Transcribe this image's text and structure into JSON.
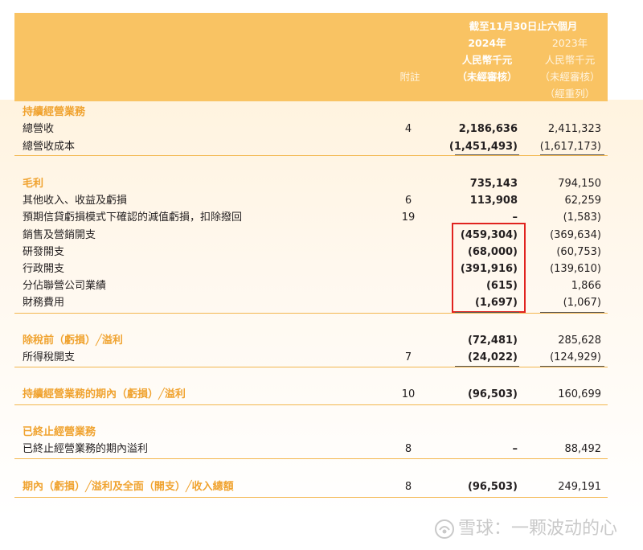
{
  "header": {
    "period": "截至11月30日止六個月",
    "col_2024_year": "2024年",
    "col_2024_unit": "人民幣千元",
    "col_2024_audit": "（未經審核）",
    "col_2023_year": "2023年",
    "col_2023_unit": "人民幣千元",
    "col_2023_audit": "（未經審核）",
    "col_2023_restated": "（經重列）",
    "notes_label": "附註"
  },
  "rows": [
    {
      "label": "持續經營業務",
      "note": "",
      "v2024": "",
      "v2023": "",
      "section": true
    },
    {
      "label": "總營收",
      "note": "4",
      "v2024": "2,186,636",
      "v2023": "2,411,323"
    },
    {
      "label": "總營收成本",
      "note": "",
      "v2024": "(1,451,493)",
      "v2023": "(1,617,173)"
    },
    {
      "label": "毛利",
      "note": "",
      "v2024": "735,143",
      "v2023": "794,150",
      "section": true
    },
    {
      "label": "其他收入、收益及虧損",
      "note": "6",
      "v2024": "113,908",
      "v2023": "62,259"
    },
    {
      "label": "預期信貸虧損模式下確認的減值虧損，扣除撥回",
      "note": "19",
      "v2024": "–",
      "v2023": "(1,583)"
    },
    {
      "label": "銷售及營銷開支",
      "note": "",
      "v2024": "(459,304)",
      "v2023": "(369,634)"
    },
    {
      "label": "研發開支",
      "note": "",
      "v2024": "(68,000)",
      "v2023": "(60,753)"
    },
    {
      "label": "行政開支",
      "note": "",
      "v2024": "(391,916)",
      "v2023": "(139,610)"
    },
    {
      "label": "分佔聯營公司業績",
      "note": "",
      "v2024": "(615)",
      "v2023": "1,866"
    },
    {
      "label": "財務費用",
      "note": "",
      "v2024": "(1,697)",
      "v2023": "(1,067)"
    },
    {
      "label": "除稅前（虧損）╱溢利",
      "note": "",
      "v2024": "(72,481)",
      "v2023": "285,628",
      "section": true
    },
    {
      "label": "所得稅開支",
      "note": "7",
      "v2024": "(24,022)",
      "v2023": "(124,929)"
    },
    {
      "label": "持續經營業務的期內（虧損）╱溢利",
      "note": "10",
      "v2024": "(96,503)",
      "v2023": "160,699",
      "section": true
    },
    {
      "label": "已終止經營業務",
      "note": "",
      "v2024": "",
      "v2023": "",
      "section": true
    },
    {
      "label": "已終止經營業務的期內溢利",
      "note": "8",
      "v2024": "–",
      "v2023": "88,492"
    },
    {
      "label": "期內（虧損）╱溢利及全面（開支）╱收入總額",
      "note": "8",
      "v2024": "(96,503)",
      "v2023": "249,191",
      "section": true
    }
  ],
  "watermark": "雪球：一颗波动的心",
  "colors": {
    "header_band": "#f9c363",
    "section_text": "#f0a330",
    "highlight_box": "#e0231f"
  }
}
